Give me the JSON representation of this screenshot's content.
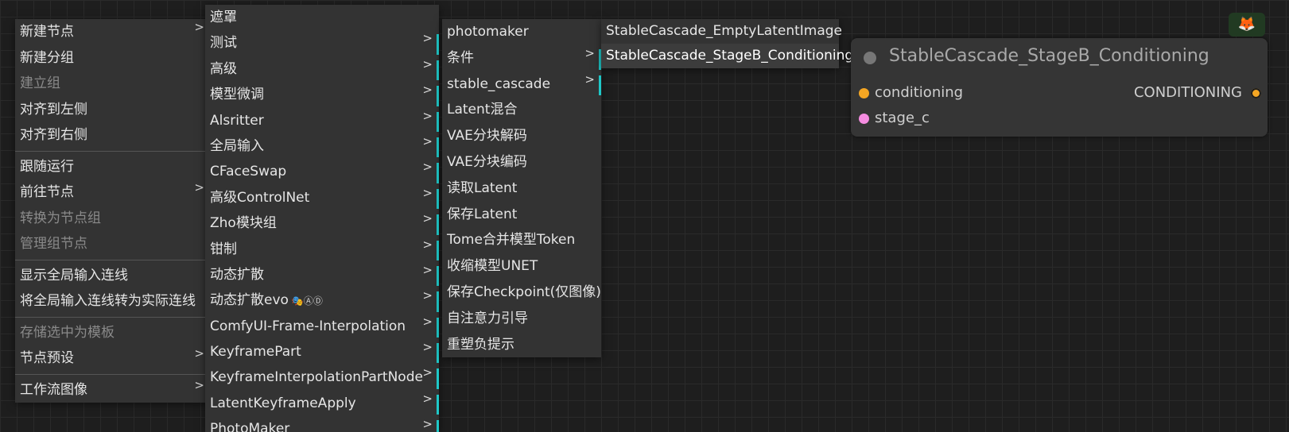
{
  "menu1": {
    "items": [
      {
        "label": "新建节点",
        "submenu": true,
        "state": "normal"
      },
      {
        "label": "新建分组",
        "submenu": false,
        "state": "normal"
      },
      {
        "label": "建立组",
        "submenu": false,
        "state": "disabled"
      },
      {
        "label": "对齐到左侧",
        "submenu": false,
        "state": "normal"
      },
      {
        "label": "对齐到右侧",
        "submenu": false,
        "state": "normal"
      },
      {
        "label": "跟随运行",
        "submenu": false,
        "state": "normal",
        "separator_before": true
      },
      {
        "label": "前往节点",
        "submenu": true,
        "state": "normal"
      },
      {
        "label": "转换为节点组",
        "submenu": false,
        "state": "disabled"
      },
      {
        "label": "管理组节点",
        "submenu": false,
        "state": "disabled"
      },
      {
        "label": "显示全局输入连线",
        "submenu": false,
        "state": "normal",
        "separator_before": true
      },
      {
        "label": "将全局输入连线转为实际连线",
        "submenu": false,
        "state": "normal"
      },
      {
        "label": "存储选中为模板",
        "submenu": false,
        "state": "disabled",
        "separator_before": true
      },
      {
        "label": "节点预设",
        "submenu": true,
        "state": "normal"
      },
      {
        "label": "工作流图像",
        "submenu": true,
        "state": "normal",
        "separator_before": true
      }
    ]
  },
  "menu2": {
    "items": [
      {
        "label": "遮罩",
        "submenu": false
      },
      {
        "label": "测试",
        "submenu": true
      },
      {
        "label": "高级",
        "submenu": true
      },
      {
        "label": "模型微调",
        "submenu": true
      },
      {
        "label": "Alsritter",
        "submenu": true
      },
      {
        "label": "全局输入",
        "submenu": true
      },
      {
        "label": "CFaceSwap",
        "submenu": true
      },
      {
        "label": "高级ControlNet",
        "submenu": true
      },
      {
        "label": "Zho模块组",
        "submenu": true
      },
      {
        "label": "钳制",
        "submenu": true
      },
      {
        "label": "动态扩散",
        "submenu": true
      },
      {
        "label": "动态扩散evo",
        "submenu": true,
        "suffix": "🎭ⒶⒹ"
      },
      {
        "label": "ComfyUI-Frame-Interpolation",
        "submenu": true
      },
      {
        "label": "KeyframePart",
        "submenu": true
      },
      {
        "label": "KeyframeInterpolationPartNode",
        "submenu": true
      },
      {
        "label": "LatentKeyframeApply",
        "submenu": true
      },
      {
        "label": "PhotoMaker",
        "submenu": true
      }
    ]
  },
  "menu3": {
    "items": [
      {
        "label": "photomaker",
        "submenu": false
      },
      {
        "label": "条件",
        "submenu": true
      },
      {
        "label": "stable_cascade",
        "submenu": true
      },
      {
        "label": "Latent混合",
        "submenu": false
      },
      {
        "label": "VAE分块解码",
        "submenu": false
      },
      {
        "label": "VAE分块编码",
        "submenu": false
      },
      {
        "label": "读取Latent",
        "submenu": false
      },
      {
        "label": "保存Latent",
        "submenu": false
      },
      {
        "label": "Tome合并模型Token",
        "submenu": false
      },
      {
        "label": "收缩模型UNET",
        "submenu": false
      },
      {
        "label": "保存Checkpoint(仅图像)",
        "submenu": false
      },
      {
        "label": "自注意力引导",
        "submenu": false
      },
      {
        "label": "重塑负提示",
        "submenu": false
      }
    ]
  },
  "menu4": {
    "items": [
      {
        "label": "StableCascade_EmptyLatentImage",
        "highlight": false
      },
      {
        "label": "StableCascade_StageB_Conditioning",
        "highlight": true
      }
    ]
  },
  "node": {
    "title": "StableCascade_StageB_Conditioning",
    "inputs": [
      {
        "name": "conditioning",
        "color": "#f5a623"
      },
      {
        "name": "stage_c",
        "color": "#f58ce0"
      }
    ],
    "outputs": [
      {
        "name": "CONDITIONING",
        "color": "#f5a623"
      }
    ]
  },
  "icons": {
    "submenu_arrow": ">",
    "fox_logo": "🦊"
  },
  "colors": {
    "menu_bg": "#333333",
    "accent_bar": "#1fc8c8",
    "disabled_text": "#8a8a8a"
  }
}
